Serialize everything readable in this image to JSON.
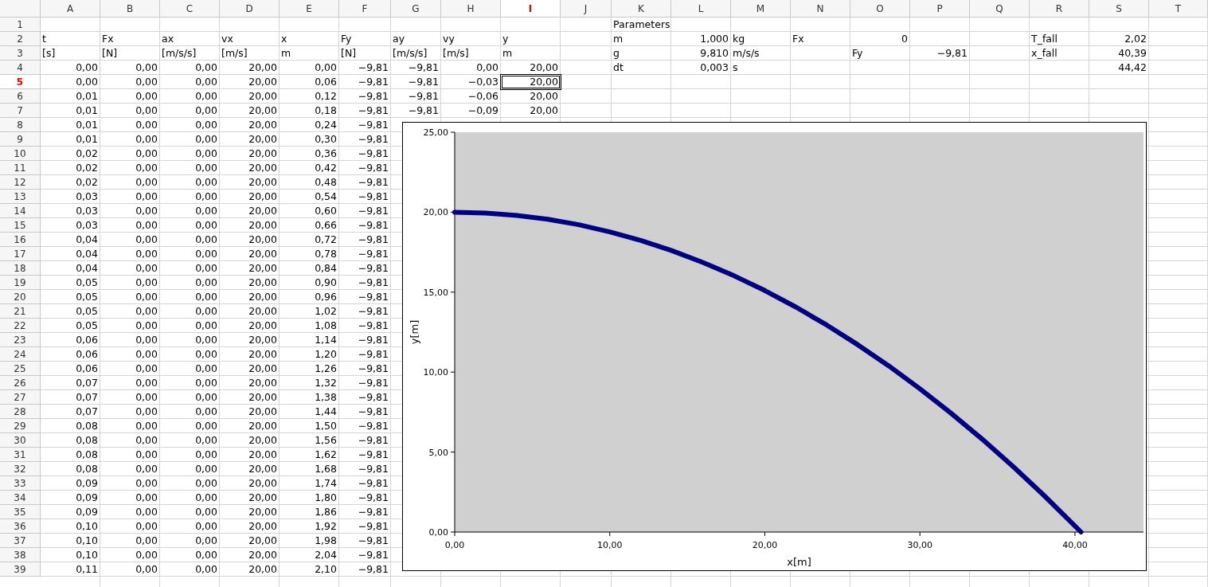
{
  "sheet": {
    "columns": [
      {
        "label": "A",
        "selected": false
      },
      {
        "label": "B",
        "selected": false
      },
      {
        "label": "C",
        "selected": false
      },
      {
        "label": "D",
        "selected": false
      },
      {
        "label": "E",
        "selected": false
      },
      {
        "label": "F",
        "selected": false
      },
      {
        "label": "G",
        "selected": false
      },
      {
        "label": "H",
        "selected": false
      },
      {
        "label": "I",
        "selected": true
      },
      {
        "label": "J",
        "selected": false
      },
      {
        "label": "K",
        "selected": false
      },
      {
        "label": "L",
        "selected": false
      },
      {
        "label": "M",
        "selected": false
      },
      {
        "label": "N",
        "selected": false
      },
      {
        "label": "O",
        "selected": false
      },
      {
        "label": "P",
        "selected": false
      },
      {
        "label": "Q",
        "selected": false
      },
      {
        "label": "R",
        "selected": false
      },
      {
        "label": "S",
        "selected": false
      },
      {
        "label": "T",
        "selected": false
      }
    ],
    "rows": [
      {
        "label": "1",
        "selected": false,
        "cells": [
          "",
          "",
          "",
          "",
          "",
          "",
          "",
          "",
          "",
          "",
          "Parameters"
        ]
      },
      {
        "label": "2",
        "selected": false,
        "cells": [
          "t",
          "Fx",
          "ax",
          "vx",
          "x",
          "Fy",
          "ay",
          "vy",
          "y",
          "",
          "m",
          "1,000",
          "kg",
          "Fx",
          "0",
          "",
          "",
          "T_fall",
          "2,02"
        ]
      },
      {
        "label": "3",
        "selected": false,
        "cells": [
          "[s]",
          "[N]",
          "[m/s/s]",
          "[m/s]",
          "m",
          "[N]",
          "[m/s/s]",
          "[m/s]",
          "m",
          "",
          "g",
          "9,810",
          "m/s/s",
          "",
          "Fy",
          "−9,81",
          "",
          "x_fall",
          "40,39"
        ]
      },
      {
        "label": "4",
        "selected": false,
        "cells": [
          "0,00",
          "0,00",
          "0,00",
          "20,00",
          "0,00",
          "−9,81",
          "−9,81",
          "0,00",
          "20,00",
          "",
          "dt",
          "0,003",
          "s",
          "",
          "",
          "",
          "",
          "",
          "44,42"
        ]
      },
      {
        "label": "5",
        "selected": true,
        "cells": [
          "0,00",
          "0,00",
          "0,00",
          "20,00",
          "0,06",
          "−9,81",
          "−9,81",
          "−0,03",
          "20,00"
        ]
      },
      {
        "label": "6",
        "selected": false,
        "cells": [
          "0,01",
          "0,00",
          "0,00",
          "20,00",
          "0,12",
          "−9,81",
          "−9,81",
          "−0,06",
          "20,00"
        ]
      },
      {
        "label": "7",
        "selected": false,
        "cells": [
          "0,01",
          "0,00",
          "0,00",
          "20,00",
          "0,18",
          "−9,81",
          "−9,81",
          "−0,09",
          "20,00"
        ]
      },
      {
        "label": "8",
        "selected": false,
        "cells": [
          "0,01",
          "0,00",
          "0,00",
          "20,00",
          "0,24",
          "−9,81"
        ]
      },
      {
        "label": "9",
        "selected": false,
        "cells": [
          "0,01",
          "0,00",
          "0,00",
          "20,00",
          "0,30",
          "−9,81"
        ]
      },
      {
        "label": "10",
        "selected": false,
        "cells": [
          "0,02",
          "0,00",
          "0,00",
          "20,00",
          "0,36",
          "−9,81"
        ]
      },
      {
        "label": "11",
        "selected": false,
        "cells": [
          "0,02",
          "0,00",
          "0,00",
          "20,00",
          "0,42",
          "−9,81"
        ]
      },
      {
        "label": "12",
        "selected": false,
        "cells": [
          "0,02",
          "0,00",
          "0,00",
          "20,00",
          "0,48",
          "−9,81"
        ]
      },
      {
        "label": "13",
        "selected": false,
        "cells": [
          "0,03",
          "0,00",
          "0,00",
          "20,00",
          "0,54",
          "−9,81"
        ]
      },
      {
        "label": "14",
        "selected": false,
        "cells": [
          "0,03",
          "0,00",
          "0,00",
          "20,00",
          "0,60",
          "−9,81"
        ]
      },
      {
        "label": "15",
        "selected": false,
        "cells": [
          "0,03",
          "0,00",
          "0,00",
          "20,00",
          "0,66",
          "−9,81"
        ]
      },
      {
        "label": "16",
        "selected": false,
        "cells": [
          "0,04",
          "0,00",
          "0,00",
          "20,00",
          "0,72",
          "−9,81"
        ]
      },
      {
        "label": "17",
        "selected": false,
        "cells": [
          "0,04",
          "0,00",
          "0,00",
          "20,00",
          "0,78",
          "−9,81"
        ]
      },
      {
        "label": "18",
        "selected": false,
        "cells": [
          "0,04",
          "0,00",
          "0,00",
          "20,00",
          "0,84",
          "−9,81"
        ]
      },
      {
        "label": "19",
        "selected": false,
        "cells": [
          "0,05",
          "0,00",
          "0,00",
          "20,00",
          "0,90",
          "−9,81"
        ]
      },
      {
        "label": "20",
        "selected": false,
        "cells": [
          "0,05",
          "0,00",
          "0,00",
          "20,00",
          "0,96",
          "−9,81"
        ]
      },
      {
        "label": "21",
        "selected": false,
        "cells": [
          "0,05",
          "0,00",
          "0,00",
          "20,00",
          "1,02",
          "−9,81"
        ]
      },
      {
        "label": "22",
        "selected": false,
        "cells": [
          "0,05",
          "0,00",
          "0,00",
          "20,00",
          "1,08",
          "−9,81"
        ]
      },
      {
        "label": "23",
        "selected": false,
        "cells": [
          "0,06",
          "0,00",
          "0,00",
          "20,00",
          "1,14",
          "−9,81"
        ]
      },
      {
        "label": "24",
        "selected": false,
        "cells": [
          "0,06",
          "0,00",
          "0,00",
          "20,00",
          "1,20",
          "−9,81"
        ]
      },
      {
        "label": "25",
        "selected": false,
        "cells": [
          "0,06",
          "0,00",
          "0,00",
          "20,00",
          "1,26",
          "−9,81"
        ]
      },
      {
        "label": "26",
        "selected": false,
        "cells": [
          "0,07",
          "0,00",
          "0,00",
          "20,00",
          "1,32",
          "−9,81"
        ]
      },
      {
        "label": "27",
        "selected": false,
        "cells": [
          "0,07",
          "0,00",
          "0,00",
          "20,00",
          "1,38",
          "−9,81"
        ]
      },
      {
        "label": "28",
        "selected": false,
        "cells": [
          "0,07",
          "0,00",
          "0,00",
          "20,00",
          "1,44",
          "−9,81"
        ]
      },
      {
        "label": "29",
        "selected": false,
        "cells": [
          "0,08",
          "0,00",
          "0,00",
          "20,00",
          "1,50",
          "−9,81"
        ]
      },
      {
        "label": "30",
        "selected": false,
        "cells": [
          "0,08",
          "0,00",
          "0,00",
          "20,00",
          "1,56",
          "−9,81"
        ]
      },
      {
        "label": "31",
        "selected": false,
        "cells": [
          "0,08",
          "0,00",
          "0,00",
          "20,00",
          "1,62",
          "−9,81"
        ]
      },
      {
        "label": "32",
        "selected": false,
        "cells": [
          "0,08",
          "0,00",
          "0,00",
          "20,00",
          "1,68",
          "−9,81"
        ]
      },
      {
        "label": "33",
        "selected": false,
        "cells": [
          "0,09",
          "0,00",
          "0,00",
          "20,00",
          "1,74",
          "−9,81"
        ]
      },
      {
        "label": "34",
        "selected": false,
        "cells": [
          "0,09",
          "0,00",
          "0,00",
          "20,00",
          "1,80",
          "−9,81"
        ]
      },
      {
        "label": "35",
        "selected": false,
        "cells": [
          "0,09",
          "0,00",
          "0,00",
          "20,00",
          "1,86",
          "−9,81"
        ]
      },
      {
        "label": "36",
        "selected": false,
        "cells": [
          "0,10",
          "0,00",
          "0,00",
          "20,00",
          "1,92",
          "−9,81"
        ]
      },
      {
        "label": "37",
        "selected": false,
        "cells": [
          "0,10",
          "0,00",
          "0,00",
          "20,00",
          "1,98",
          "−9,81"
        ]
      },
      {
        "label": "38",
        "selected": false,
        "cells": [
          "0,10",
          "0,00",
          "0,00",
          "20,00",
          "2,04",
          "−9,81"
        ]
      },
      {
        "label": "39",
        "selected": false,
        "cells": [
          "0,11",
          "0,00",
          "0,00",
          "20,00",
          "2,10",
          "−9,81"
        ]
      }
    ]
  },
  "chart": {
    "chart_data": {
      "type": "line",
      "xlabel": "x[m]",
      "ylabel": "y[m]",
      "x": [
        0,
        2,
        4,
        6,
        8,
        10,
        12,
        14,
        16,
        18,
        20,
        22,
        24,
        26,
        28,
        30,
        32,
        34,
        36,
        38,
        40,
        40.39
      ],
      "series": [
        {
          "color": "#000080",
          "values": [
            20,
            19.95,
            19.8,
            19.56,
            19.22,
            18.77,
            18.23,
            17.6,
            16.86,
            16.03,
            15.1,
            14.07,
            12.94,
            11.71,
            10.39,
            8.96,
            7.44,
            5.82,
            4.11,
            2.29,
            0.38,
            0
          ]
        }
      ],
      "xlim": [
        0,
        44.42
      ],
      "ylim": [
        0,
        25
      ],
      "xticks": [
        {
          "value": 0,
          "label": "0,00"
        },
        {
          "value": 10,
          "label": "10,00"
        },
        {
          "value": 20,
          "label": "20,00"
        },
        {
          "value": 30,
          "label": "30,00"
        },
        {
          "value": 40,
          "label": "40,00"
        }
      ],
      "yticks": [
        {
          "value": 0,
          "label": "0,00"
        },
        {
          "value": 5,
          "label": "5,00"
        },
        {
          "value": 10,
          "label": "10,00"
        },
        {
          "value": 15,
          "label": "15,00"
        },
        {
          "value": 20,
          "label": "20,00"
        },
        {
          "value": 25,
          "label": "25,00"
        }
      ]
    }
  }
}
